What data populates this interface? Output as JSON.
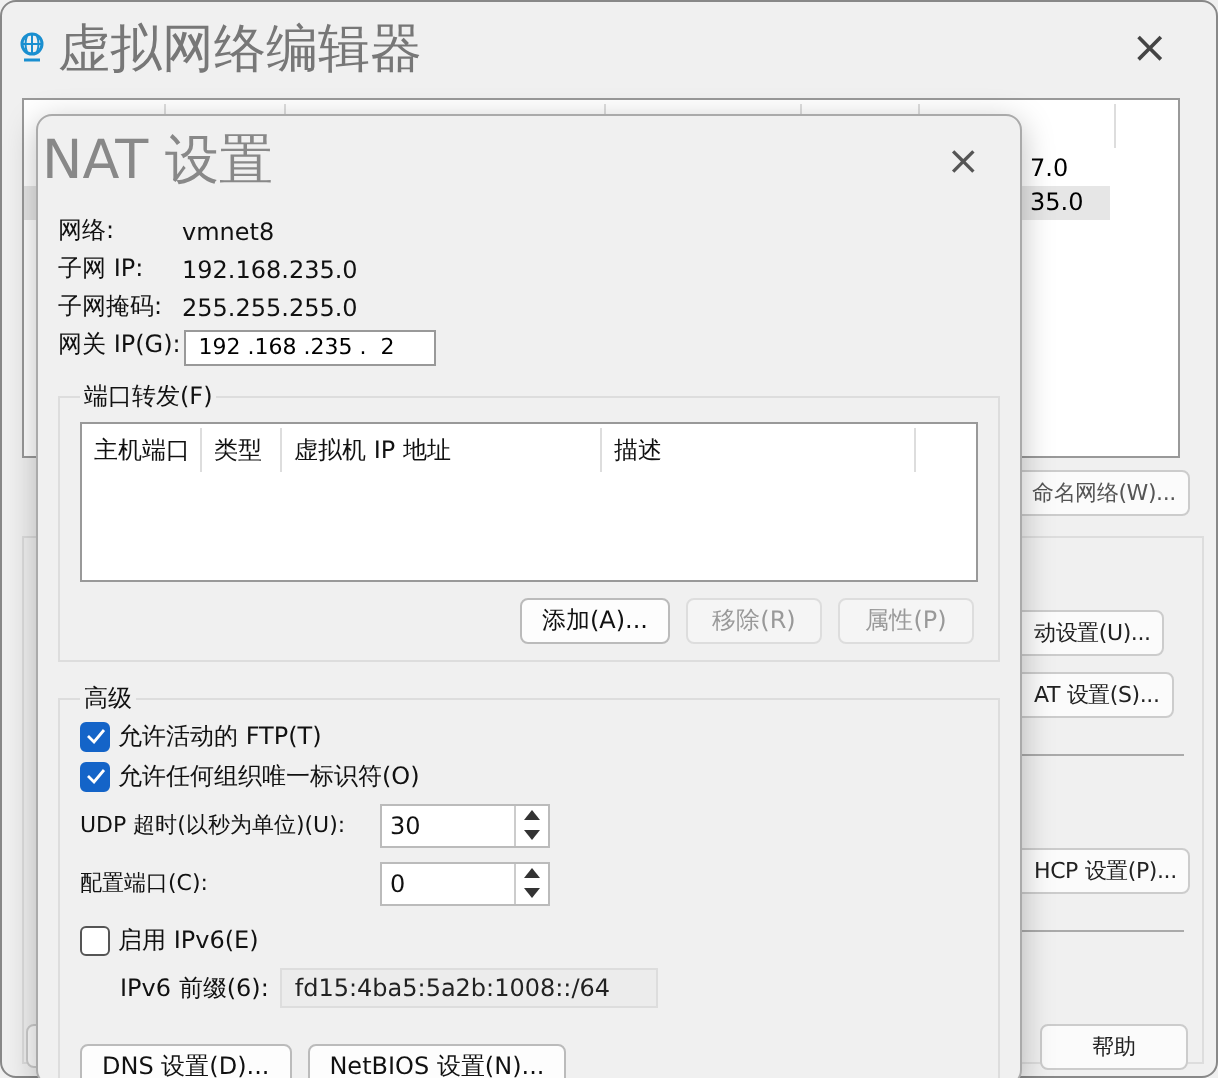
{
  "main_window": {
    "title": "虚拟网络编辑器",
    "close": "×",
    "table": {
      "rows": [
        {
          "cell": "7.0",
          "selected": false
        },
        {
          "cell": "35.0",
          "selected": true
        }
      ]
    },
    "rename_button": "命名网络(W)...",
    "settings_buttons": [
      "动设置(U)...",
      "AT 设置(S)..."
    ],
    "dhcp_button": "HCP 设置(P)...",
    "help_button": "帮助"
  },
  "nat_dialog": {
    "title": "NAT 设置",
    "close": "×",
    "info": [
      {
        "label": "网络:",
        "value": "vmnet8"
      },
      {
        "label": "子网 IP:",
        "value": "192.168.235.0"
      },
      {
        "label": "子网掩码:",
        "value": "255.255.255.0"
      }
    ],
    "gateway": {
      "label": "网关 IP(G):",
      "value": "192 .168 .235 .  2"
    },
    "port_forwarding": {
      "legend": "端口转发(F)",
      "columns": [
        "主机端口",
        "类型",
        "虚拟机 IP 地址",
        "描述"
      ],
      "buttons": [
        {
          "label": "添加(A)...",
          "disabled": false
        },
        {
          "label": "移除(R)",
          "disabled": true
        },
        {
          "label": "属性(P)",
          "disabled": true
        }
      ]
    },
    "advanced": {
      "legend": "高级",
      "checkboxes": [
        {
          "label": "允许活动的 FTP(T)",
          "checked": true
        },
        {
          "label": "允许任何组织唯一标识符(O)",
          "checked": true
        }
      ],
      "spinners": [
        {
          "label": "UDP 超时(以秒为单位)(U):",
          "value": "30"
        },
        {
          "label": "配置端口(C):",
          "value": "0"
        }
      ],
      "ipv6": {
        "label": "启用 IPv6(E)",
        "checked": false
      },
      "prefix": {
        "label": "IPv6 前缀(6):",
        "value": "fd15:4ba5:5a2b:1008::/64",
        "disabled": true
      },
      "buttons": [
        "DNS 设置(D)...",
        "NetBIOS 设置(N)..."
      ]
    }
  }
}
